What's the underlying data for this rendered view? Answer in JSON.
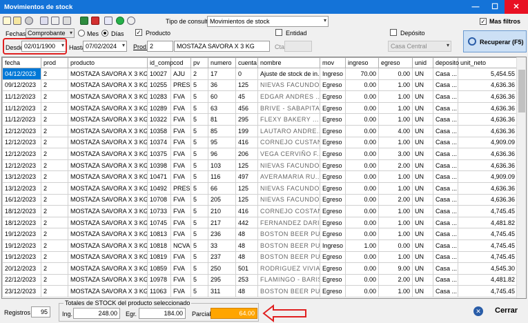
{
  "window": {
    "title": "Movimientos de stock",
    "minimize": "—",
    "maximize": "☐",
    "close": "✕"
  },
  "toolbar": {
    "icons": [
      "new-icon",
      "edit-icon",
      "settings-icon",
      "print-icon",
      "copy-icon",
      "delete-icon",
      "excel-icon",
      "pdf-icon",
      "email-icon",
      "whatsapp-icon",
      "search-icon"
    ]
  },
  "tipo_consulta": {
    "label": "Tipo de consulta",
    "value": "Movimientos de stock"
  },
  "mas_filtros": {
    "label": "Mas filtros",
    "checked": true
  },
  "filters": {
    "fechas_label": "Fechas",
    "fechas_value": "Comprobante",
    "mes": "Mes",
    "dias": "Días",
    "desde_label": "Desde",
    "desde": "02/01/1900",
    "hasta_label": "Hasta",
    "hasta": "07/02/2024",
    "producto_label": "Producto",
    "prod_label": "Prod.",
    "prod_code": "2",
    "prod_name": "MOSTAZA SAVORA X 3 KG",
    "entidad_label": "Entidad",
    "cta_label": "Cta",
    "deposito_label": "Depósito",
    "deposito_value": "Casa Central"
  },
  "recuperar": {
    "label": "Recuperar (F5)"
  },
  "grid": {
    "headers": [
      "fecha",
      "prod",
      "producto",
      "id_comp",
      "cod",
      "pv",
      "numero",
      "cuenta",
      "nombre",
      "mov",
      "ingreso",
      "egreso",
      "unid",
      "deposito",
      "unit_neto"
    ],
    "rows": [
      [
        "04/12/2023",
        "2",
        "MOSTAZA SAVORA X 3 KG",
        "10027",
        "AJU",
        "2",
        "17",
        "0",
        "Ajuste de stock de in...",
        "Ingreso",
        "70.00",
        "0.00",
        "UN",
        "Casa ...",
        "5,454.55"
      ],
      [
        "09/12/2023",
        "2",
        "MOSTAZA SAVORA X 3 KG",
        "10255",
        "PRES",
        "5",
        "36",
        "125",
        "NIEVAS FACUNDO ...",
        "Egreso",
        "0.00",
        "1.00",
        "UN",
        "Casa ...",
        "4,636.36"
      ],
      [
        "11/12/2023",
        "2",
        "MOSTAZA SAVORA X 3 KG",
        "10283",
        "FVA",
        "5",
        "60",
        "45",
        "EDGAR ANDRES ...",
        "Egreso",
        "0.00",
        "1.00",
        "UN",
        "Casa ...",
        "4,636.36"
      ],
      [
        "11/12/2023",
        "2",
        "MOSTAZA SAVORA X 3 KG",
        "10289",
        "FVA",
        "5",
        "63",
        "456",
        "BRIVE - SABAPITAS...",
        "Egreso",
        "0.00",
        "1.00",
        "UN",
        "Casa ...",
        "4,636.36"
      ],
      [
        "11/12/2023",
        "2",
        "MOSTAZA SAVORA X 3 KG",
        "10322",
        "FVA",
        "5",
        "81",
        "295",
        "FLEXY BAKERY ...",
        "Egreso",
        "0.00",
        "1.00",
        "UN",
        "Casa ...",
        "4,636.36"
      ],
      [
        "12/12/2023",
        "2",
        "MOSTAZA SAVORA X 3 KG",
        "10358",
        "FVA",
        "5",
        "85",
        "199",
        "LAUTARO ANDRE...",
        "Egreso",
        "0.00",
        "4.00",
        "UN",
        "Casa ...",
        "4,636.36"
      ],
      [
        "12/12/2023",
        "2",
        "MOSTAZA SAVORA X 3 KG",
        "10374",
        "FVA",
        "5",
        "95",
        "416",
        "CORNEJO CUSTAN...",
        "Egreso",
        "0.00",
        "1.00",
        "UN",
        "Casa ...",
        "4,909.09"
      ],
      [
        "12/12/2023",
        "2",
        "MOSTAZA SAVORA X 3 KG",
        "10375",
        "FVA",
        "5",
        "96",
        "206",
        "VEGA CERVIÑO F...",
        "Egreso",
        "0.00",
        "3.00",
        "UN",
        "Casa ...",
        "4,636.36"
      ],
      [
        "12/12/2023",
        "2",
        "MOSTAZA SAVORA X 3 KG",
        "10398",
        "FVA",
        "5",
        "103",
        "125",
        "NIEVAS FACUNDO ...",
        "Egreso",
        "0.00",
        "2.00",
        "UN",
        "Casa ...",
        "4,636.36"
      ],
      [
        "13/12/2023",
        "2",
        "MOSTAZA SAVORA X 3 KG",
        "10471",
        "FVA",
        "5",
        "116",
        "497",
        "AVERAMARIA RU...",
        "Egreso",
        "0.00",
        "1.00",
        "UN",
        "Casa ...",
        "4,909.09"
      ],
      [
        "13/12/2023",
        "2",
        "MOSTAZA SAVORA X 3 KG",
        "10492",
        "PRES",
        "5",
        "66",
        "125",
        "NIEVAS FACUNDO ...",
        "Egreso",
        "0.00",
        "1.00",
        "UN",
        "Casa ...",
        "4,636.36"
      ],
      [
        "16/12/2023",
        "2",
        "MOSTAZA SAVORA X 3 KG",
        "10708",
        "FVA",
        "5",
        "205",
        "125",
        "NIEVAS FACUNDO ...",
        "Egreso",
        "0.00",
        "2.00",
        "UN",
        "Casa ...",
        "4,636.36"
      ],
      [
        "18/12/2023",
        "2",
        "MOSTAZA SAVORA X 3 KG",
        "10733",
        "FVA",
        "5",
        "210",
        "416",
        "CORNEJO COSTAN...",
        "Egreso",
        "0.00",
        "1.00",
        "UN",
        "Casa ...",
        "4,745.45"
      ],
      [
        "18/12/2023",
        "2",
        "MOSTAZA SAVORA X 3 KG",
        "10745",
        "FVA",
        "5",
        "217",
        "442",
        "FERNANDEZ DARIO",
        "Egreso",
        "0.00",
        "1.00",
        "UN",
        "Casa ...",
        "4,481.82"
      ],
      [
        "19/12/2023",
        "2",
        "MOSTAZA SAVORA X 3 KG",
        "10813",
        "FVA",
        "5",
        "236",
        "48",
        "BOSTON BEER PUB...",
        "Egreso",
        "0.00",
        "1.00",
        "UN",
        "Casa ...",
        "4,745.45"
      ],
      [
        "19/12/2023",
        "2",
        "MOSTAZA SAVORA X 3 KG",
        "10818",
        "NCVA",
        "5",
        "33",
        "48",
        "BOSTON BEER PUB...",
        "Ingreso",
        "1.00",
        "0.00",
        "UN",
        "Casa ...",
        "4,745.45"
      ],
      [
        "19/12/2023",
        "2",
        "MOSTAZA SAVORA X 3 KG",
        "10819",
        "FVA",
        "5",
        "237",
        "48",
        "BOSTON BEER PUB...",
        "Egreso",
        "0.00",
        "1.00",
        "UN",
        "Casa ...",
        "4,745.45"
      ],
      [
        "20/12/2023",
        "2",
        "MOSTAZA SAVORA X 3 KG",
        "10859",
        "FVA",
        "5",
        "250",
        "501",
        "RODRIGUEZ VIVIAN...",
        "Egreso",
        "0.00",
        "9.00",
        "UN",
        "Casa ...",
        "4,545.30"
      ],
      [
        "22/12/2023",
        "2",
        "MOSTAZA SAVORA X 3 KG",
        "10978",
        "FVA",
        "5",
        "295",
        "253",
        "FLAMINGO - BARIST...",
        "Egreso",
        "0.00",
        "2.00",
        "UN",
        "Casa ...",
        "4,481.82"
      ],
      [
        "23/12/2023",
        "2",
        "MOSTAZA SAVORA X 3 KG",
        "11063",
        "FVA",
        "5",
        "311",
        "48",
        "BOSTON BEER PUB...",
        "Egreso",
        "0.00",
        "1.00",
        "UN",
        "Casa ...",
        "4,745.45"
      ]
    ]
  },
  "footer": {
    "registros_label": "Registros",
    "registros": "95",
    "totales_title": "Totales de STOCK del producto seleccionado",
    "ing_label": "Ing.",
    "ing": "248.00",
    "egr_label": "Egr.",
    "egr": "184.00",
    "parcial_label": "Parcial",
    "parcial": "64.00",
    "cerrar": "Cerrar"
  },
  "colors": {
    "title_bar": "#1473d8",
    "selected_cell": "#0078d7",
    "parcial_bg": "#ffa500",
    "highlight": "#e02020"
  }
}
